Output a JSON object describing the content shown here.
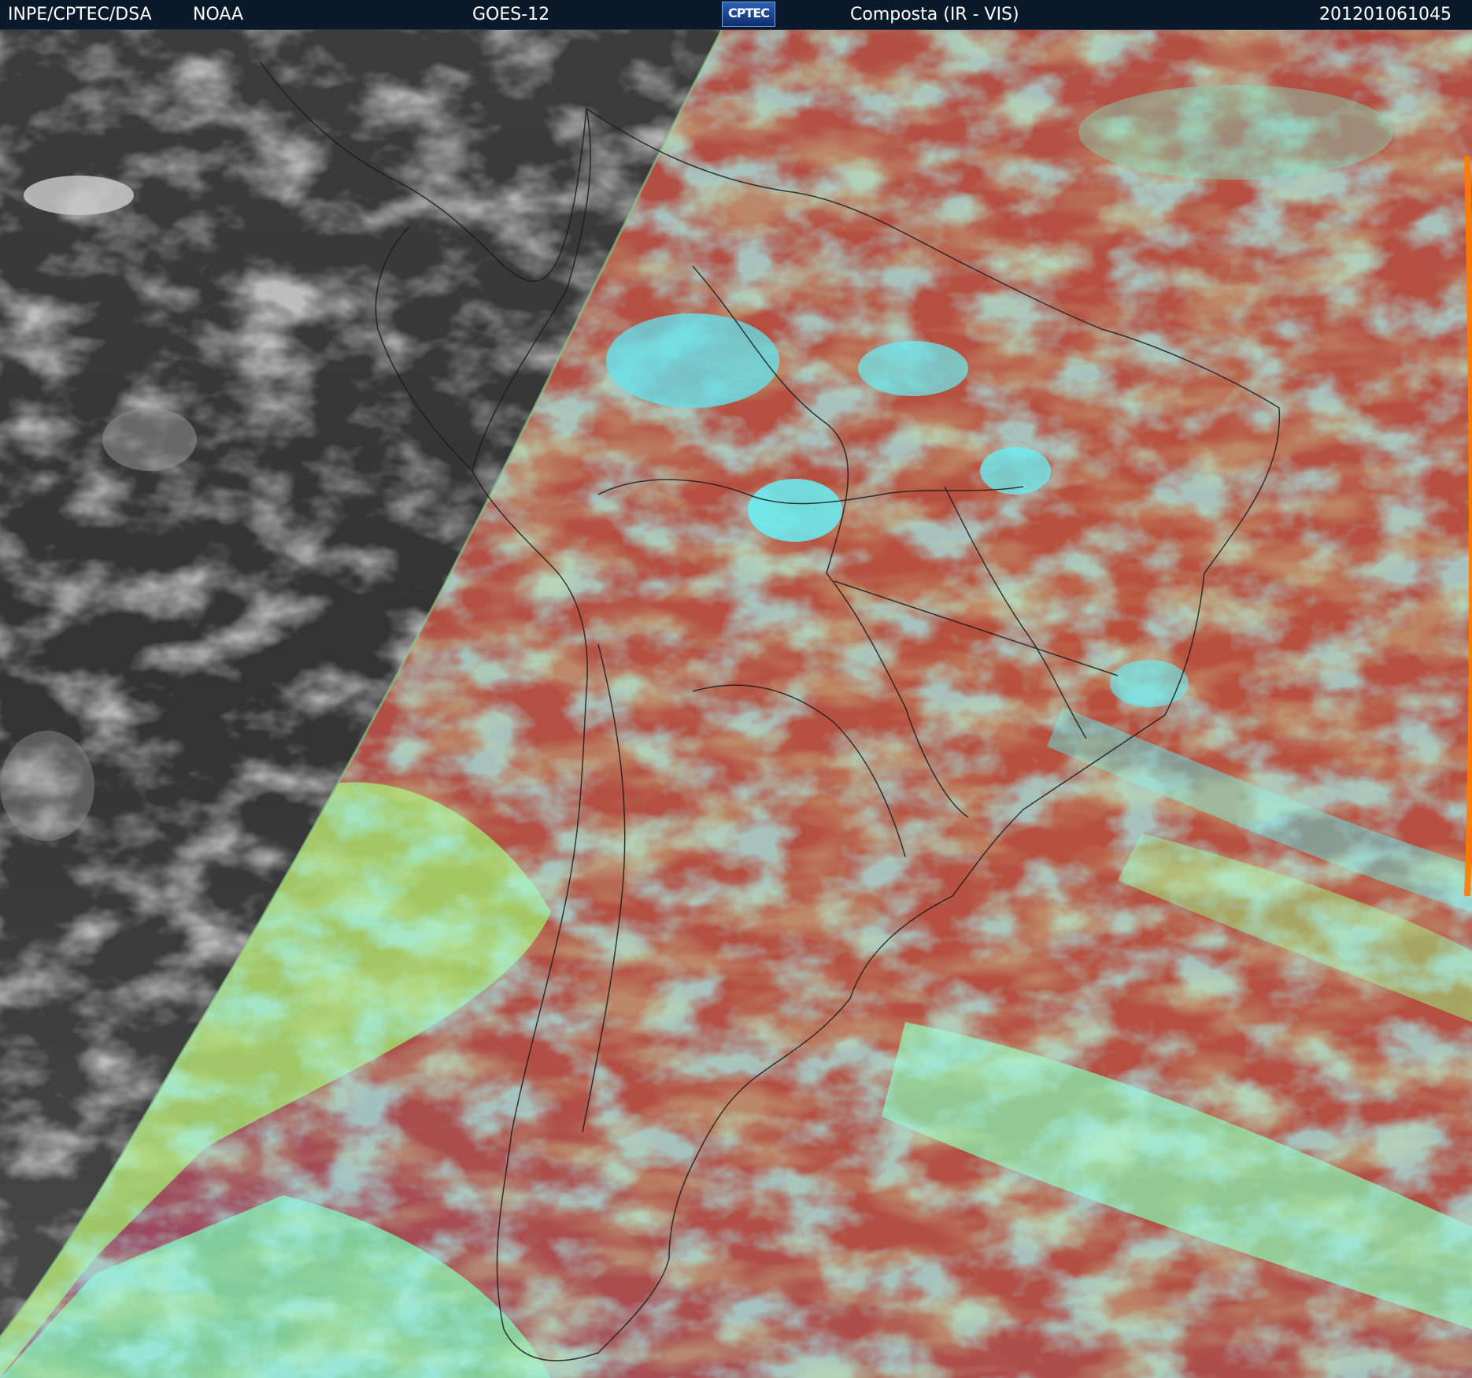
{
  "header": {
    "source": "INPE/CPTEC/DSA",
    "agency": "NOAA",
    "satellite": "GOES-12",
    "logo_text": "CPTEC",
    "product": "Composta (IR - VIS)",
    "timestamp": "201201061045"
  },
  "colors": {
    "header_bg": "#0b1a2a",
    "night_gray": "#3a3a3a",
    "land_red": "#b5523e",
    "cloud_cyan": "#5fe3e0",
    "cloud_green": "#9be86a",
    "boundary_line": "#1a1a1a",
    "limb_orange": "#ff7a00"
  }
}
